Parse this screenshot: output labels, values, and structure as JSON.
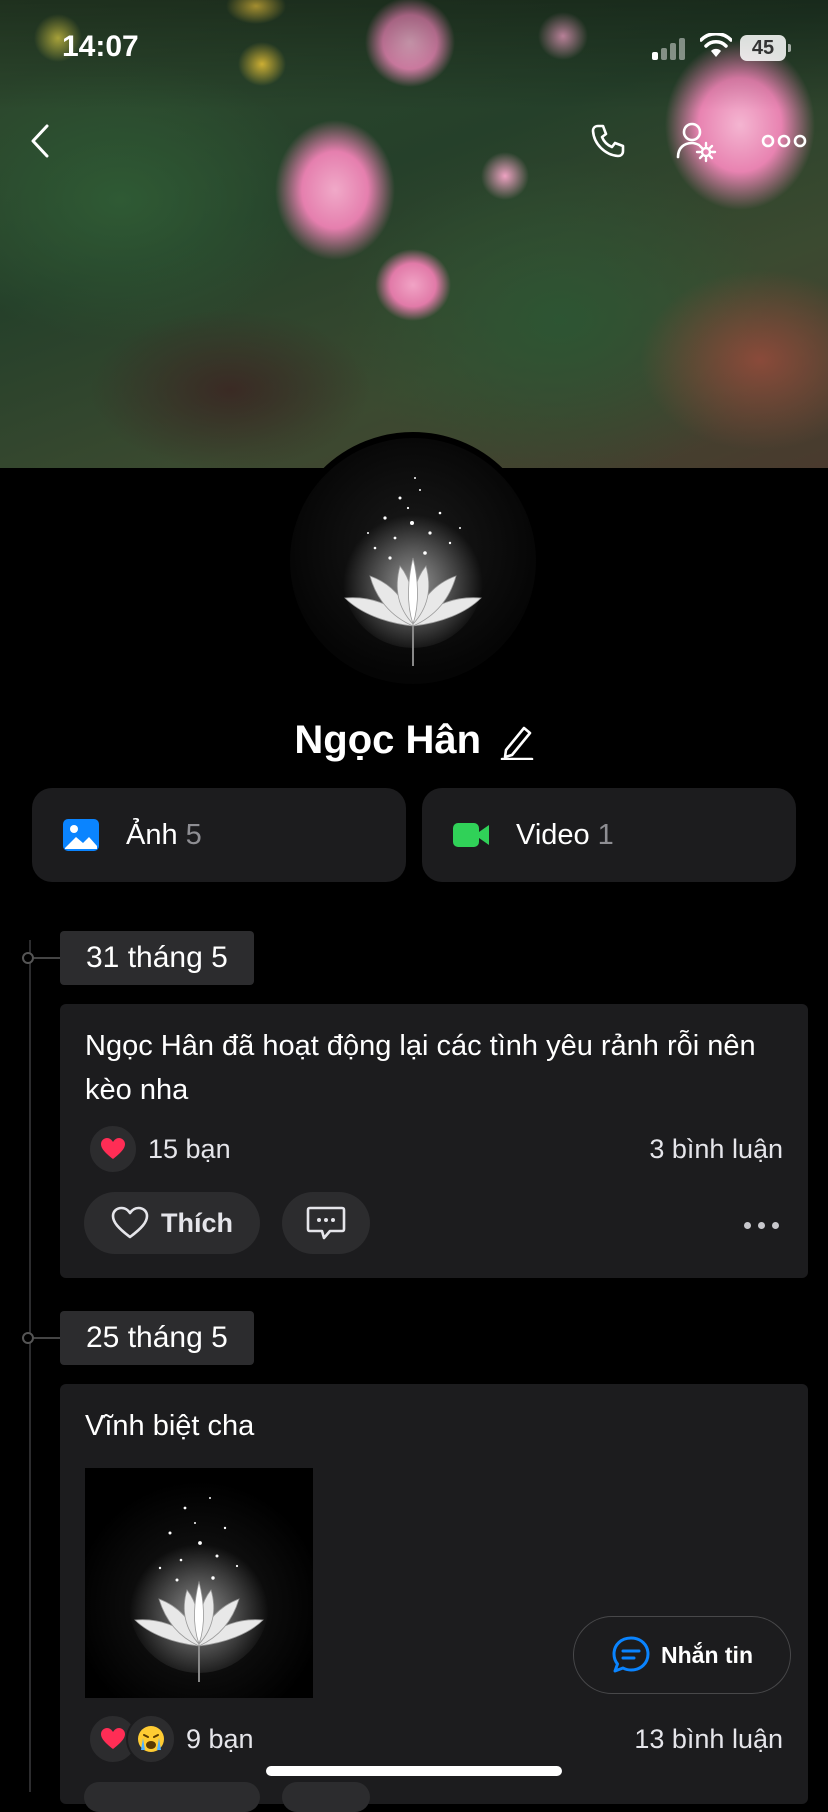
{
  "status_bar": {
    "time": "14:07",
    "battery": "45"
  },
  "profile": {
    "name": "Ngọc Hân"
  },
  "media": {
    "photos": {
      "label": "Ảnh",
      "count": "5"
    },
    "videos": {
      "label": "Video",
      "count": "1"
    }
  },
  "posts": [
    {
      "date": "31 tháng 5",
      "text": "Ngọc Hân đã hoạt động lại các tình yêu rảnh rỗi nên kèo nha",
      "reactions": "15 bạn",
      "comments": "3 bình luận",
      "like_label": "Thích"
    },
    {
      "date": "25 tháng 5",
      "text": "Vĩnh biệt cha",
      "reactions": "9 bạn",
      "comments": "13 bình luận"
    }
  ],
  "fab": {
    "label": "Nhắn tin"
  },
  "colors": {
    "background": "#000000",
    "card": "#1c1c1e",
    "chip": "#2c2c2e",
    "accent_blue": "#0a84ff",
    "accent_green": "#30d158",
    "heart": "#ff2d55"
  }
}
